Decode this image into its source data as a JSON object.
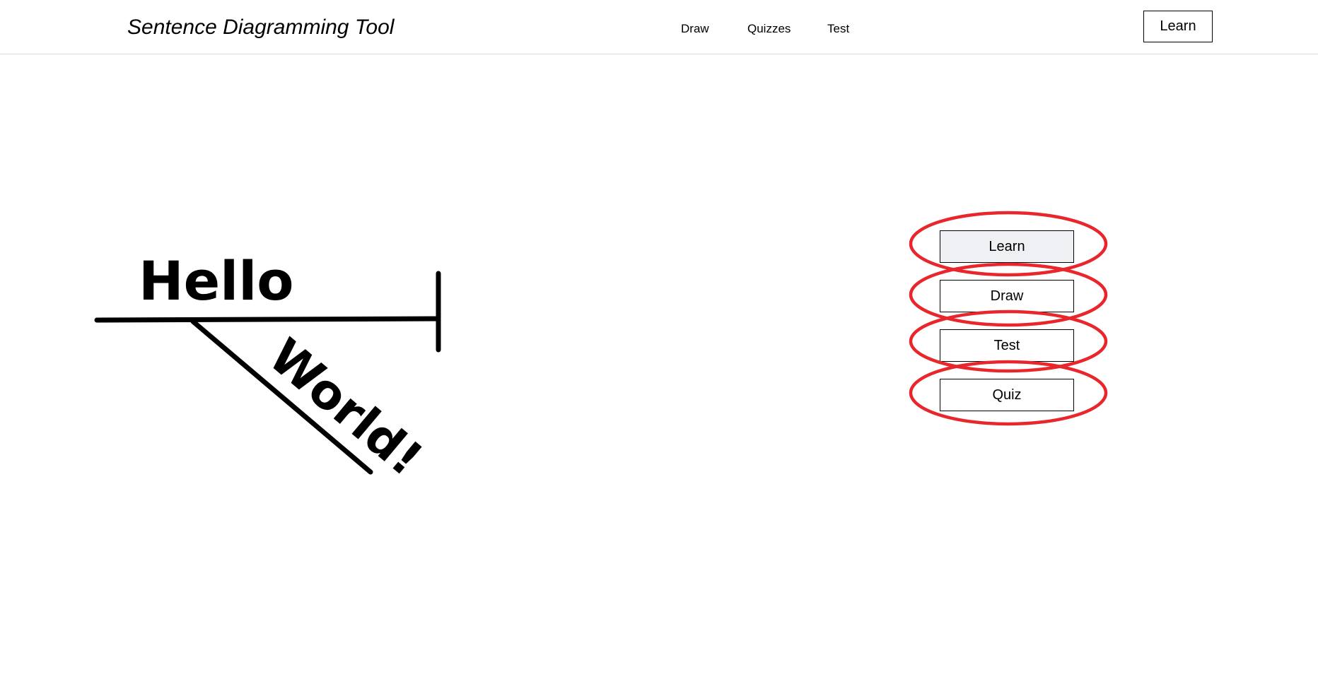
{
  "header": {
    "title": "Sentence Diagramming Tool",
    "nav": {
      "draw": "Draw",
      "quizzes": "Quizzes",
      "test": "Test"
    },
    "learn_button": "Learn"
  },
  "diagram": {
    "words": {
      "top": "Hello",
      "slant": "World!"
    }
  },
  "menu": {
    "buttons": [
      "Learn",
      "Draw",
      "Test",
      "Quiz"
    ],
    "active": "Learn",
    "highlight_color": "#e8262b"
  }
}
